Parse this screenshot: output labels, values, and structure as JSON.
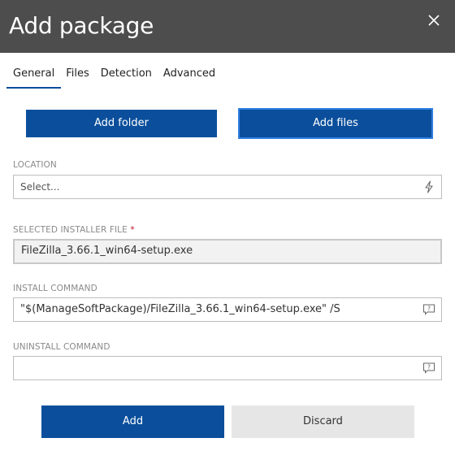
{
  "dialog": {
    "title": "Add package"
  },
  "tabs": [
    {
      "label": "General",
      "active": true
    },
    {
      "label": "Files",
      "active": false
    },
    {
      "label": "Detection",
      "active": false
    },
    {
      "label": "Advanced",
      "active": false
    }
  ],
  "actions": {
    "add_folder": "Add folder",
    "add_files": "Add files"
  },
  "location": {
    "label": "LOCATION",
    "placeholder": "Select...",
    "icon": "lightning-icon"
  },
  "installer_file": {
    "label": "SELECTED INSTALLER FILE",
    "required_marker": "*",
    "value": "FileZilla_3.66.1_win64-setup.exe"
  },
  "install_command": {
    "label": "INSTALL COMMAND",
    "value": "\"$(ManageSoftPackage)/FileZilla_3.66.1_win64-setup.exe\" /S",
    "icon": "help-comment-icon"
  },
  "uninstall_command": {
    "label": "UNINSTALL COMMAND",
    "value": "",
    "icon": "help-comment-icon"
  },
  "footer": {
    "add": "Add",
    "discard": "Discard"
  },
  "colors": {
    "header_bg": "#4d4d4d",
    "primary": "#0b4f9c",
    "required": "#c8102e",
    "secondary_button": "#e6e6e6"
  }
}
